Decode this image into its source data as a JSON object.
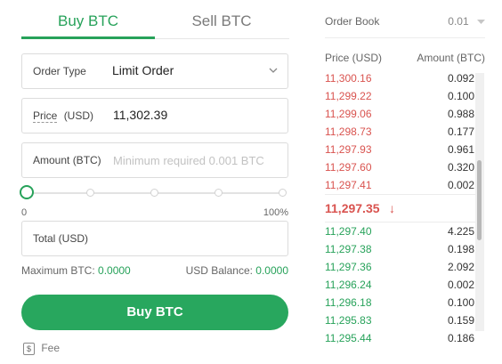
{
  "tabs": {
    "buy": "Buy BTC",
    "sell": "Sell BTC"
  },
  "order_type": {
    "label": "Order Type",
    "value": "Limit Order"
  },
  "price": {
    "label": "Price",
    "unit": "(USD)",
    "value": "11,302.39"
  },
  "amount": {
    "label": "Amount (BTC)",
    "placeholder": "Minimum required 0.001 BTC"
  },
  "slider": {
    "min_label": "0",
    "max_label": "100%",
    "value_fraction": 0
  },
  "total": {
    "label": "Total (USD)"
  },
  "balances": {
    "max_btc_label": "Maximum BTC:",
    "max_btc_value": "0.0000",
    "usd_balance_label": "USD Balance:",
    "usd_balance_value": "0.0000"
  },
  "buy_button": "Buy BTC",
  "fee": {
    "icon": "$",
    "label": "Fee"
  },
  "order_book": {
    "title": "Order Book",
    "precision": "0.01",
    "col_price": "Price (USD)",
    "col_amount": "Amount (BTC)",
    "asks": [
      {
        "price": "11,300.16",
        "amount": "0.092"
      },
      {
        "price": "11,299.22",
        "amount": "0.100"
      },
      {
        "price": "11,299.06",
        "amount": "0.988"
      },
      {
        "price": "11,298.73",
        "amount": "0.177"
      },
      {
        "price": "11,297.93",
        "amount": "0.961"
      },
      {
        "price": "11,297.60",
        "amount": "0.320"
      },
      {
        "price": "11,297.41",
        "amount": "0.002"
      }
    ],
    "last_price": "11,297.35",
    "last_arrow": "↓",
    "bids": [
      {
        "price": "11,297.40",
        "amount": "4.225"
      },
      {
        "price": "11,297.38",
        "amount": "0.198"
      },
      {
        "price": "11,297.36",
        "amount": "2.092"
      },
      {
        "price": "11,296.24",
        "amount": "0.002"
      },
      {
        "price": "11,296.18",
        "amount": "0.100"
      },
      {
        "price": "11,295.83",
        "amount": "0.159"
      },
      {
        "price": "11,295.44",
        "amount": "0.186"
      }
    ]
  },
  "colors": {
    "accent": "#28a75e",
    "ask": "#d9534f",
    "bid": "#27a25a"
  }
}
